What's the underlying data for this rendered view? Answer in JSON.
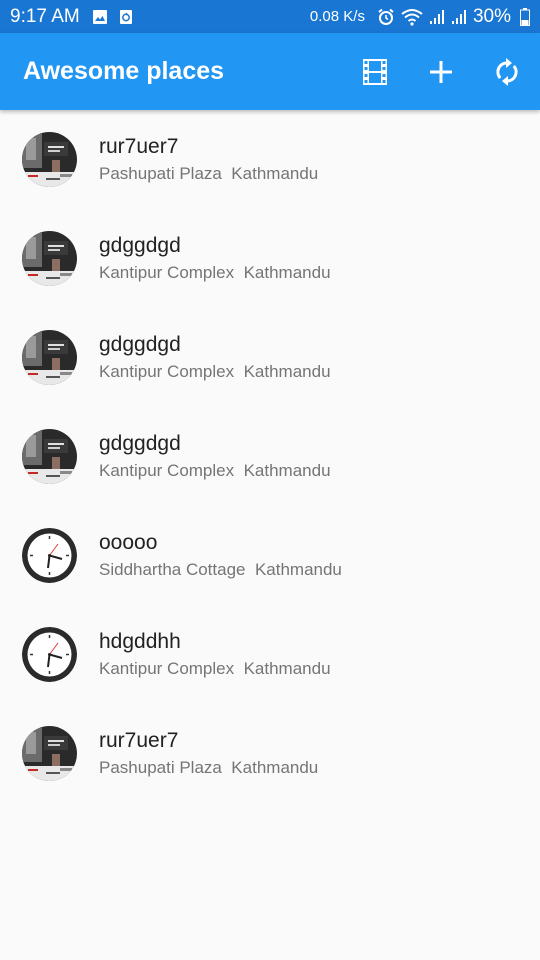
{
  "status_bar": {
    "time": "9:17 AM",
    "network_speed": "0.08 K/s",
    "battery": "30%",
    "icons": [
      "image-icon",
      "sync-icon",
      "alarm-icon",
      "wifi-icon",
      "signal-icon",
      "signal-icon",
      "battery-icon"
    ]
  },
  "app_bar": {
    "title": "Awesome places",
    "actions": [
      "movie-icon",
      "add-icon",
      "refresh-icon"
    ]
  },
  "colors": {
    "status_bar": "#1976d2",
    "app_bar": "#2196f3",
    "background": "#fafafa"
  },
  "places": [
    {
      "title": "rur7uer7",
      "subtitle": "Pashupati Plaza  Kathmandu",
      "avatar": "photo"
    },
    {
      "title": "gdggdgd",
      "subtitle": "Kantipur Complex  Kathmandu",
      "avatar": "photo"
    },
    {
      "title": "gdggdgd",
      "subtitle": "Kantipur Complex  Kathmandu",
      "avatar": "photo"
    },
    {
      "title": "gdggdgd",
      "subtitle": "Kantipur Complex  Kathmandu",
      "avatar": "photo"
    },
    {
      "title": "ooooo",
      "subtitle": "Siddhartha Cottage  Kathmandu",
      "avatar": "clock"
    },
    {
      "title": "hdgddhh",
      "subtitle": "Kantipur Complex  Kathmandu",
      "avatar": "clock"
    },
    {
      "title": "rur7uer7",
      "subtitle": "Pashupati Plaza  Kathmandu",
      "avatar": "photo"
    }
  ]
}
